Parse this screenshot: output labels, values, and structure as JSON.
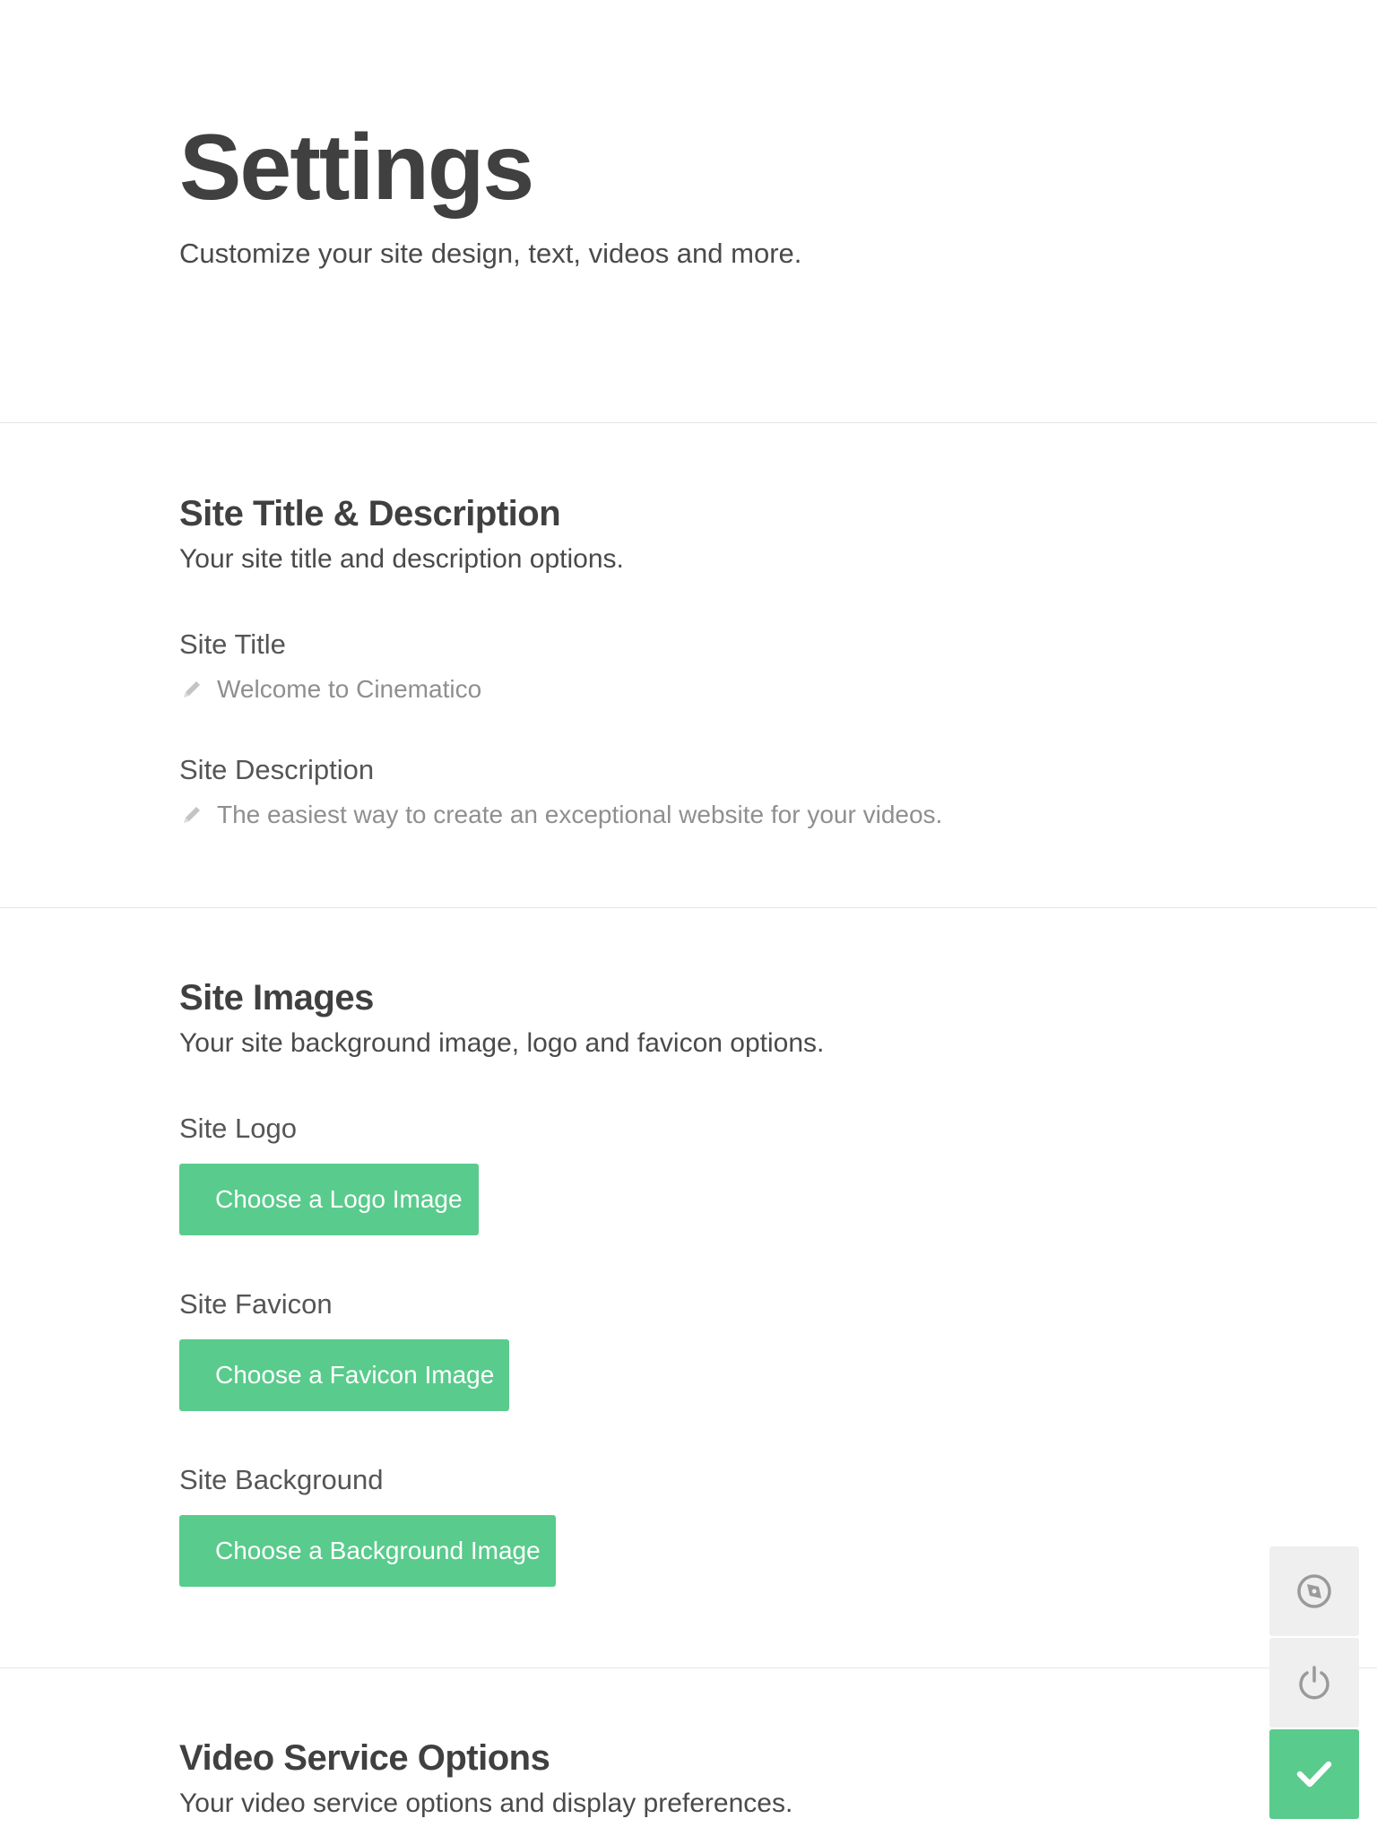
{
  "header": {
    "title": "Settings",
    "subtitle": "Customize your site design, text, videos and more."
  },
  "sections": {
    "title_description": {
      "heading": "Site Title & Description",
      "subheading": "Your site title and description options.",
      "site_title_label": "Site Title",
      "site_title_value": "Welcome to Cinematico",
      "site_description_label": "Site Description",
      "site_description_value": "The easiest way to create an exceptional website for your videos."
    },
    "images": {
      "heading": "Site Images",
      "subheading": "Your site background image, logo and favicon options.",
      "logo_label": "Site Logo",
      "logo_button": "Choose a Logo Image",
      "favicon_label": "Site Favicon",
      "favicon_button": "Choose a Favicon Image",
      "background_label": "Site Background",
      "background_button": "Choose a Background Image"
    },
    "video_service": {
      "heading": "Video Service Options",
      "subheading": "Your video service options and display preferences."
    }
  },
  "floating_actions": {
    "icons": [
      "compass-icon",
      "power-icon",
      "checkmark-icon"
    ]
  },
  "colors": {
    "accent": "#59cb8c",
    "text_dark": "#404040",
    "text_muted": "#8f8f8f",
    "side_button_gray": "#efefef"
  }
}
